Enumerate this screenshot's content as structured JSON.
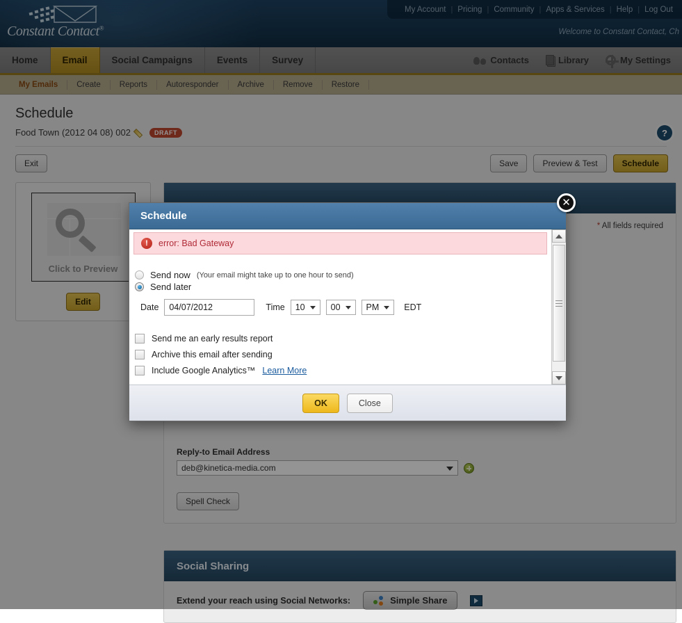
{
  "brand": {
    "name": "Constant Contact",
    "trademark": "®",
    "welcome": "Welcome to Constant Contact, Ch"
  },
  "top_links": [
    {
      "label": "My Account"
    },
    {
      "label": "Pricing"
    },
    {
      "label": "Community"
    },
    {
      "label": "Apps & Services"
    },
    {
      "label": "Help"
    },
    {
      "label": "Log Out"
    }
  ],
  "main_nav": {
    "tabs": [
      {
        "label": "Home",
        "active": false
      },
      {
        "label": "Email",
        "active": true
      },
      {
        "label": "Social Campaigns",
        "active": false
      },
      {
        "label": "Events",
        "active": false
      },
      {
        "label": "Survey",
        "active": false
      }
    ],
    "right_items": [
      {
        "label": "Contacts",
        "icon": "contacts-icon"
      },
      {
        "label": "Library",
        "icon": "library-icon"
      },
      {
        "label": "My Settings",
        "icon": "gear-icon"
      }
    ]
  },
  "sub_nav": [
    {
      "label": "My Emails",
      "current": true
    },
    {
      "label": "Create",
      "current": false
    },
    {
      "label": "Reports",
      "current": false
    },
    {
      "label": "Autoresponder",
      "current": false
    },
    {
      "label": "Archive",
      "current": false
    },
    {
      "label": "Remove",
      "current": false
    },
    {
      "label": "Restore",
      "current": false
    }
  ],
  "page": {
    "title": "Schedule",
    "campaign_name": "Food Town (2012 04 08) 002",
    "status_badge": "DRAFT",
    "help_icon_label": "?",
    "edit_icon": "pencil-icon"
  },
  "action_bar": {
    "exit": "Exit",
    "save": "Save",
    "preview_test": "Preview & Test",
    "schedule": "Schedule"
  },
  "preview_panel": {
    "caption": "Click to Preview",
    "edit_button": "Edit",
    "icon": "magnifier-icon"
  },
  "email_panel": {
    "required_star": "*",
    "required_note": "All fields required",
    "reply_to_label": "Reply-to Email Address",
    "reply_to_value": "deb@kinetica-media.com",
    "spell_check": "Spell Check"
  },
  "social_panel": {
    "header": "Social Sharing",
    "prompt": "Extend your reach using Social Networks:",
    "share_button": "Simple Share",
    "video_icon": "play-video-icon"
  },
  "modal": {
    "title": "Schedule",
    "close_label": "✕",
    "error": {
      "icon": "!",
      "text": "error: Bad Gateway"
    },
    "send_now_label": "Send now",
    "send_now_hint": "(Your email might take up to one hour to send)",
    "send_later_label": "Send later",
    "send_now_selected": false,
    "send_later_selected": true,
    "date_label": "Date",
    "date_value": "04/07/2012",
    "time_label": "Time",
    "hour_value": "10",
    "minute_value": "00",
    "meridiem_value": "PM",
    "timezone": "EDT",
    "checkboxes": [
      {
        "label": "Send me an early results report",
        "checked": false
      },
      {
        "label": "Archive this email after sending",
        "checked": false
      },
      {
        "label": "Include Google Analytics™",
        "checked": false,
        "link": "Learn More"
      }
    ],
    "ok_button": "OK",
    "close_button": "Close"
  },
  "colors": {
    "brand_navy": "#173751",
    "accent_gold": "#c6a22c",
    "modal_blue": "#3b6a95",
    "error_bg": "#fbd9dc",
    "error_text": "#b02a37",
    "draft_badge": "#c0472f",
    "panel_header": "#24465f"
  }
}
